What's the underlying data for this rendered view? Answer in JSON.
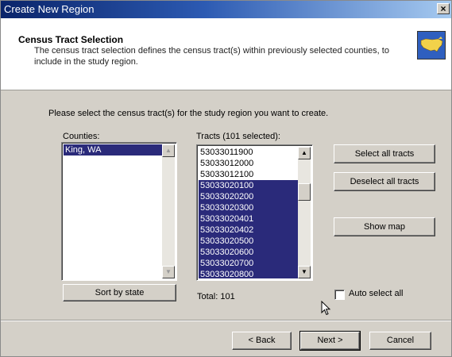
{
  "window": {
    "title": "Create New Region",
    "close_label": "×"
  },
  "header": {
    "title": "Census Tract Selection",
    "description": "The census tract selection defines the census tract(s) within previously selected counties, to include in the study region.",
    "icon": "usa-map-icon"
  },
  "instruction": "Please select the census tract(s) for the study region you want to create.",
  "counties": {
    "label": "Counties:",
    "items": [
      {
        "text": "King, WA",
        "selected": true
      }
    ],
    "sort_button": "Sort by state"
  },
  "tracts": {
    "label": "Tracts (101 selected):",
    "items": [
      {
        "text": "53033011900",
        "selected": false
      },
      {
        "text": "53033012000",
        "selected": false
      },
      {
        "text": "53033012100",
        "selected": false
      },
      {
        "text": "53033020100",
        "selected": true
      },
      {
        "text": "53033020200",
        "selected": true
      },
      {
        "text": "53033020300",
        "selected": true
      },
      {
        "text": "53033020401",
        "selected": true
      },
      {
        "text": "53033020402",
        "selected": true
      },
      {
        "text": "53033020500",
        "selected": true
      },
      {
        "text": "53033020600",
        "selected": true
      },
      {
        "text": "53033020700",
        "selected": true
      },
      {
        "text": "53033020800",
        "selected": true
      }
    ],
    "total_label": "Total: 101"
  },
  "buttons": {
    "select_all": "Select all tracts",
    "deselect_all": "Deselect all tracts",
    "show_map": "Show map",
    "back": "< Back",
    "next": "Next >",
    "cancel": "Cancel"
  },
  "auto_select": {
    "label": "Auto select all",
    "checked": false
  },
  "colors": {
    "selection": "#2a2a7a",
    "dialog_bg": "#d4d0c8",
    "title_start": "#0a246a",
    "title_end": "#a6caf0"
  }
}
